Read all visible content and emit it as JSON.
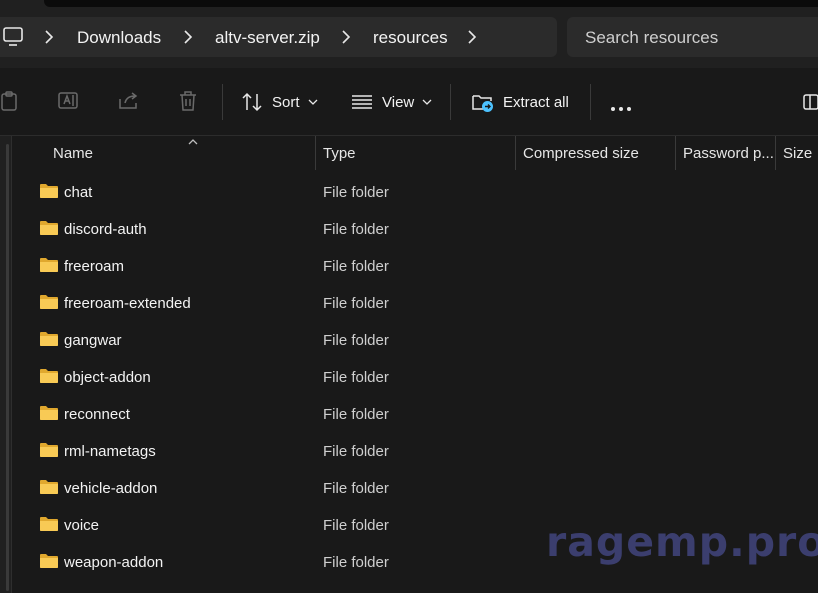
{
  "address_bar": {
    "breadcrumbs": [
      "Downloads",
      "altv-server.zip",
      "resources"
    ]
  },
  "search": {
    "placeholder": "Search resources"
  },
  "toolbar": {
    "sort_label": "Sort",
    "view_label": "View",
    "extract_label": "Extract all"
  },
  "columns": [
    "Name",
    "Type",
    "Compressed size",
    "Password p...",
    "Size"
  ],
  "files": [
    {
      "name": "chat",
      "type": "File folder"
    },
    {
      "name": "discord-auth",
      "type": "File folder"
    },
    {
      "name": "freeroam",
      "type": "File folder"
    },
    {
      "name": "freeroam-extended",
      "type": "File folder"
    },
    {
      "name": "gangwar",
      "type": "File folder"
    },
    {
      "name": "object-addon",
      "type": "File folder"
    },
    {
      "name": "reconnect",
      "type": "File folder"
    },
    {
      "name": "rml-nametags",
      "type": "File folder"
    },
    {
      "name": "vehicle-addon",
      "type": "File folder"
    },
    {
      "name": "voice",
      "type": "File folder"
    },
    {
      "name": "weapon-addon",
      "type": "File folder"
    }
  ],
  "watermark": "ragemp.pro",
  "colors": {
    "background": "#191919",
    "folder": "#f4c542",
    "accent": "#4cc2ff"
  }
}
